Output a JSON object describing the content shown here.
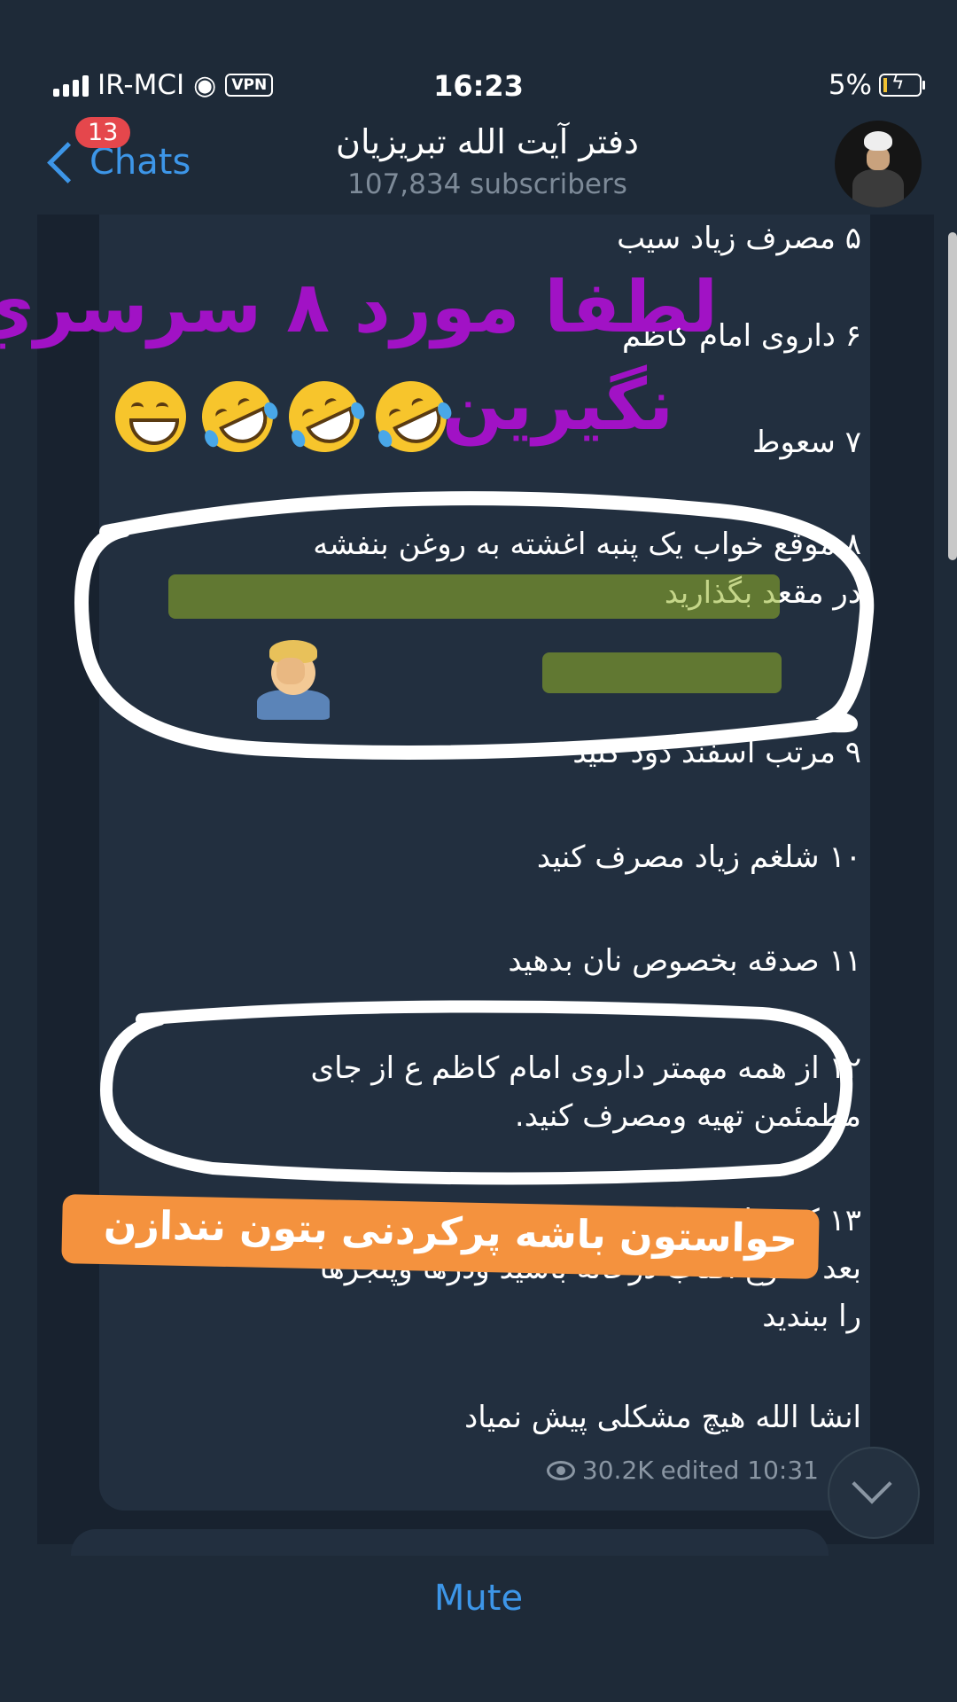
{
  "status_bar": {
    "carrier": "IR-MCI",
    "vpn_label": "VPN",
    "time": "16:23",
    "battery": "5%",
    "icons": [
      "signal-bars-icon",
      "wifi-icon",
      "battery-charging-icon"
    ]
  },
  "header": {
    "back_label": "Chats",
    "unread_badge": "13",
    "channel_title": "دفتر آیت الله تبریزیان",
    "subscribers": "107,834 subscribers"
  },
  "message": {
    "lines": [
      "۵ مصرف زیاد سیب",
      "۶ داروی امام کاظم",
      "۷ سعوط",
      "۸ موقع خواب یک پنبه اغشته به روغن بنفشه",
      "در مقعد بگذارید",
      "۹ مرتب اسفند دود کنید",
      "۱۰ شلغم زیاد مصرف کنید",
      "۱۱ صدقه بخصوص نان بدهید",
      "۱۲ از همه مهمتر داروی امام کاظم ع از جای",
      "مطمئمن تهیه ومصرف کنید.",
      "۱۳ کمتر از",
      "بعد طلوع آفتاب درخانه باشید ودرها وپنجرها",
      "را ببندید",
      "انشا الله هیچ مشکلی پیش  نمیاد"
    ],
    "views": "30.2K",
    "edited": "edited 10:31"
  },
  "overlays": {
    "purple_line_1": "لطفا مورد ۸ سرسري",
    "purple_line_2": "نگیرین",
    "orange_banner": "حواستون باشه پرکردنی بتون نندازن",
    "emojis": [
      "grinning-face-icon",
      "rofl-icon",
      "rofl-icon",
      "rofl-icon",
      "facepalm-icon"
    ]
  },
  "bottom_bar": {
    "mute_label": "Mute"
  },
  "colors": {
    "background": "#1e2a38",
    "bubble": "#222f3f",
    "accent": "#3d96e8",
    "badge": "#e5474c",
    "purple_text": "#a112c5",
    "orange_banner": "#f4923e"
  }
}
